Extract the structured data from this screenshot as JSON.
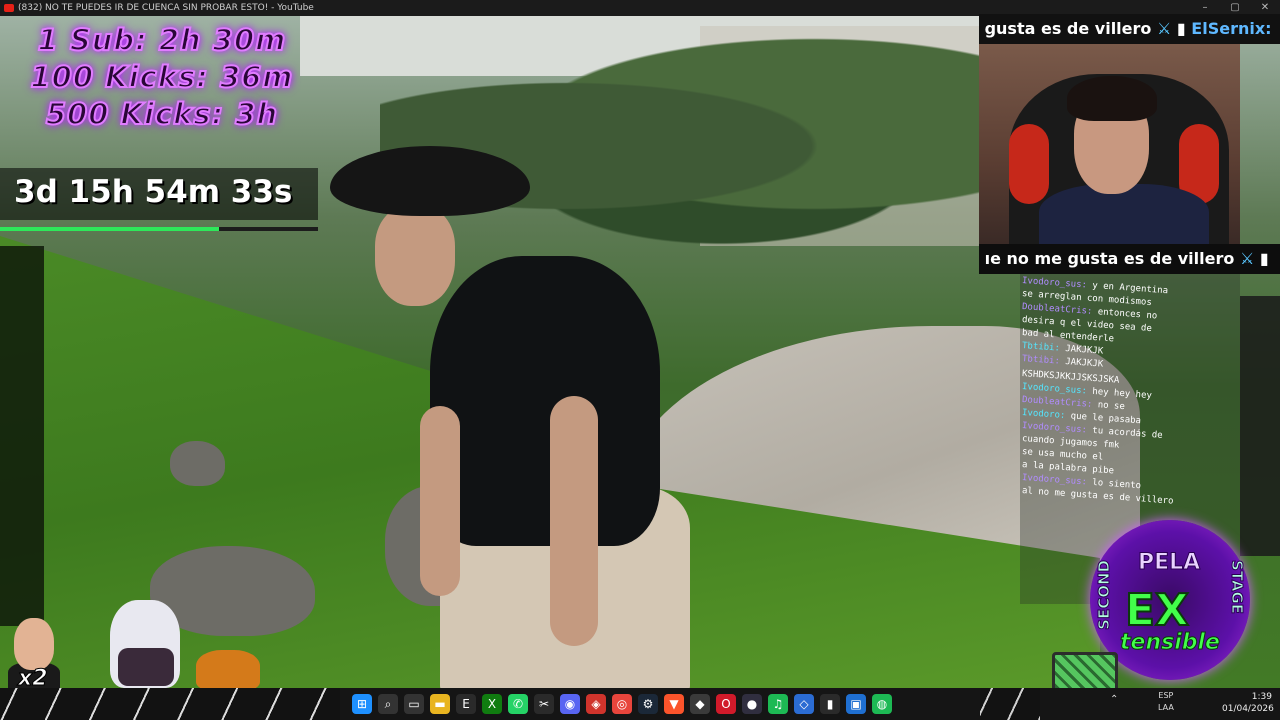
{
  "window": {
    "title": "(832) NO TE PUEDES IR DE CUENCA SIN PROBAR ESTO! - YouTube",
    "controls": [
      "–",
      "▢",
      "✕"
    ]
  },
  "overlay": {
    "subathon_lines": [
      "1 Sub: 2h 30m",
      "100 Kicks: 36m",
      "500 Kicks: 3h"
    ],
    "timer": "3d 15h 54m 33s",
    "timer_progress": 0.69,
    "accent_purple": "#e07cff",
    "accent_green": "#2ee85a"
  },
  "webcam": {
    "top_text": "gusta es de villero",
    "top_name": "ElSernix:",
    "bottom_text": "ıe no me gusta es de villero"
  },
  "chat": {
    "lines": [
      {
        "user": "Ivodoro_sus:",
        "msg": "y en Argentina"
      },
      {
        "user": "",
        "msg": "se arreglan con modismos"
      },
      {
        "user": "DoubleatCris:",
        "msg": "entonces no"
      },
      {
        "user": "",
        "msg": "desira q el video sea de"
      },
      {
        "user": "",
        "msg": "bad al entenderle"
      },
      {
        "user": "Tbtibi:",
        "msg": "JAKJKJK"
      },
      {
        "user": "Tbtibi:",
        "msg": "JAKJKJK"
      },
      {
        "user": "",
        "msg": ""
      },
      {
        "user": "",
        "msg": "KSHDKSJKKJJSKSJSKA"
      },
      {
        "user": "Ivodoro_sus:",
        "msg": "hey hey hey"
      },
      {
        "user": "DoubleatCris:",
        "msg": "no se"
      },
      {
        "user": "Ivodoro:",
        "msg": "que le pasaba"
      },
      {
        "user": "Ivodoro_sus:",
        "msg": "tu acordás de"
      },
      {
        "user": "",
        "msg": "cuando jugamos fmk"
      },
      {
        "user": "",
        "msg": "se usa mucho el"
      },
      {
        "user": "",
        "msg": "a la palabra pibe"
      },
      {
        "user": "Ivodoro_sus:",
        "msg": "lo siento"
      },
      {
        "user": "",
        "msg": "al no me gusta es de villero"
      }
    ]
  },
  "badge": {
    "top": "PELA",
    "main": "EX",
    "sub": "tensible",
    "left": "SECOND",
    "right": "STAGE"
  },
  "bottom_left": {
    "multiplier": "x2"
  },
  "taskbar": {
    "icons": [
      {
        "name": "windows-start-icon",
        "glyph": "⊞",
        "color": "#1e90ff"
      },
      {
        "name": "search-icon",
        "glyph": "⌕",
        "color": "#333333"
      },
      {
        "name": "task-view-icon",
        "glyph": "▭",
        "color": "#333333"
      },
      {
        "name": "file-explorer-icon",
        "glyph": "▬",
        "color": "#e8b420"
      },
      {
        "name": "epic-games-icon",
        "glyph": "E",
        "color": "#2a2a2a"
      },
      {
        "name": "xbox-icon",
        "glyph": "X",
        "color": "#107c10"
      },
      {
        "name": "whatsapp-icon",
        "glyph": "✆",
        "color": "#25d366"
      },
      {
        "name": "capcut-icon",
        "glyph": "✂",
        "color": "#2a2a2a"
      },
      {
        "name": "discord-icon",
        "glyph": "◉",
        "color": "#5865f2"
      },
      {
        "name": "app-red-icon",
        "glyph": "◈",
        "color": "#d0342c"
      },
      {
        "name": "chrome-icon",
        "glyph": "◎",
        "color": "#e8453c"
      },
      {
        "name": "steam-icon",
        "glyph": "⚙",
        "color": "#1b2838"
      },
      {
        "name": "brave-icon",
        "glyph": "▼",
        "color": "#fb542b"
      },
      {
        "name": "roblox-icon",
        "glyph": "◆",
        "color": "#3a3a3a"
      },
      {
        "name": "opera-icon",
        "glyph": "O",
        "color": "#d11a2a"
      },
      {
        "name": "obs-icon",
        "glyph": "●",
        "color": "#302e3f"
      },
      {
        "name": "spotify-icon",
        "glyph": "♫",
        "color": "#1db954"
      },
      {
        "name": "app-blue-icon",
        "glyph": "◇",
        "color": "#2b6cd3"
      },
      {
        "name": "terminal-icon",
        "glyph": "▮",
        "color": "#2a2a2a"
      },
      {
        "name": "app-white-icon",
        "glyph": "▣",
        "color": "#1f6fd1"
      },
      {
        "name": "app-green-icon",
        "glyph": "◍",
        "color": "#1db954"
      }
    ],
    "tray": [
      "⌃",
      "♪",
      "🔋"
    ],
    "lang_top": "ESP",
    "lang_bottom": "LAA",
    "time": "1:39",
    "date": "01/04/2026"
  }
}
